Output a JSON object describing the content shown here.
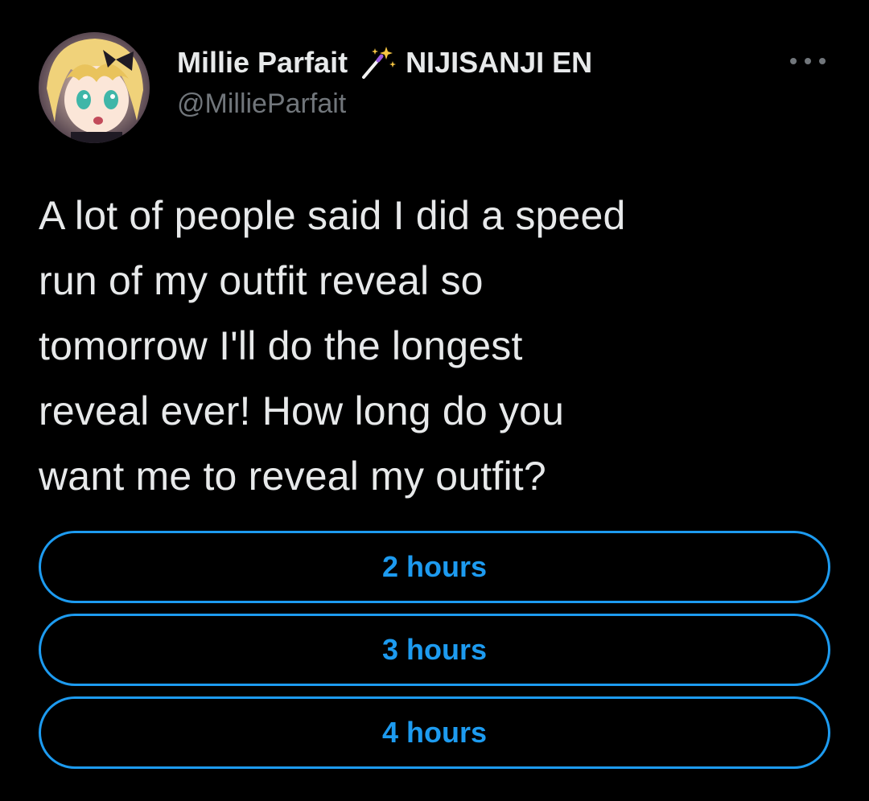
{
  "tweet": {
    "author": {
      "display_name": "Millie Parfait",
      "badge_icon": "magic-wand-icon",
      "affiliation": "NIJISANJI EN",
      "handle": "@MillieParfait"
    },
    "text_lines": [
      "A lot of people said I did a speed",
      "run of my outfit reveal so",
      "tomorrow I'll do the longest",
      "reveal ever! How long do you",
      "want me to reveal my outfit?"
    ],
    "poll": {
      "options": [
        {
          "label": "2 hours"
        },
        {
          "label": "3 hours"
        },
        {
          "label": "4 hours"
        }
      ]
    }
  },
  "colors": {
    "background": "#000000",
    "text": "#e7e9ea",
    "secondary_text": "#71767b",
    "accent": "#1d9bf0"
  }
}
